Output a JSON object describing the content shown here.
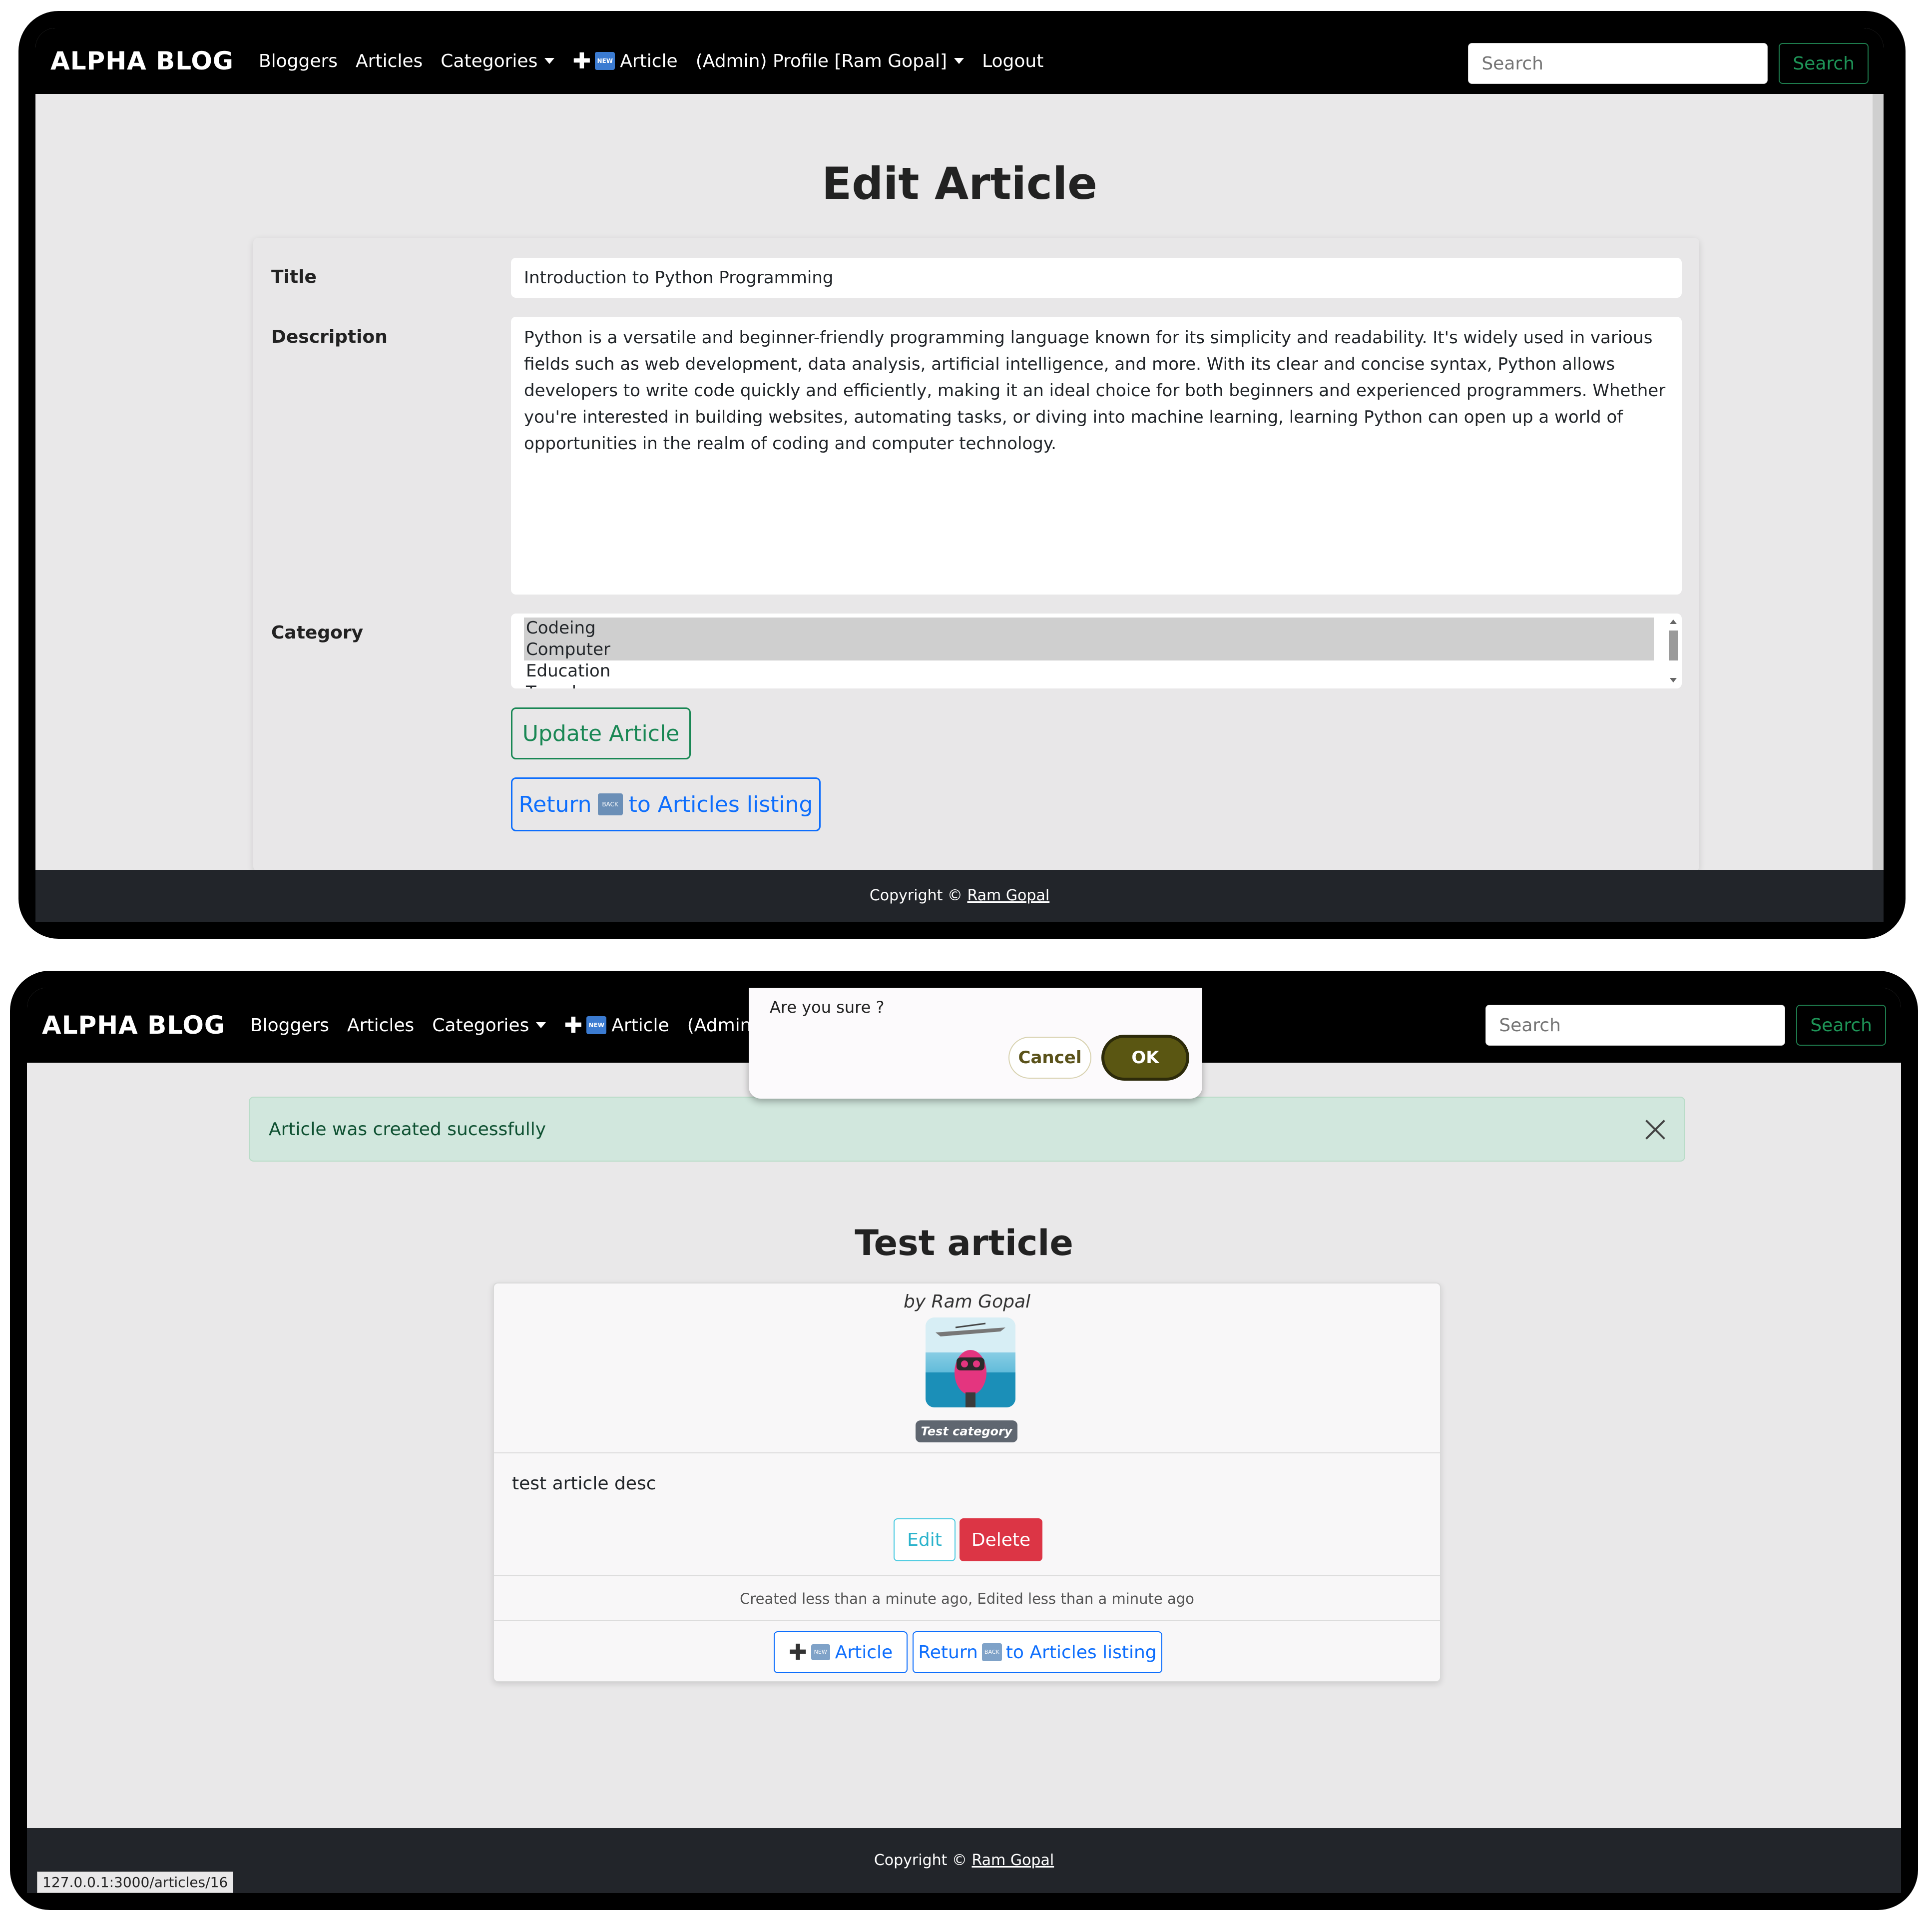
{
  "navbar": {
    "brand": "ALPHA BLOG",
    "items": {
      "bloggers": "Bloggers",
      "articles": "Articles",
      "categories": "Categories",
      "new_article": "Article",
      "profile": "(Admin) Profile [Ram Gopal]",
      "profile_truncated": "(Admin) P",
      "logout": "Logout"
    },
    "search_placeholder": "Search",
    "search_button": "Search"
  },
  "edit_page": {
    "heading": "Edit Article",
    "form": {
      "title_label": "Title",
      "title_value": "Introduction to Python Programming",
      "description_label": "Description",
      "description_value": "Python is a versatile and beginner-friendly programming language known for its simplicity and readability. It's widely used in various fields such as web development, data analysis, artificial intelligence, and more. With its clear and concise syntax, Python allows developers to write code quickly and efficiently, making it an ideal choice for both beginners and experienced programmers. Whether you're interested in building websites, automating tasks, or diving into machine learning, learning Python can open up a world of opportunities in the realm of coding and computer technology.",
      "category_label": "Category",
      "category_options": [
        "Codeing",
        "Computer",
        "Education",
        "Travel"
      ],
      "selected_categories": [
        "Codeing",
        "Computer"
      ],
      "update_button": "Update Article",
      "return_button_prefix": "Return",
      "return_button_suffix": "to Articles listing"
    },
    "footer": {
      "copyright": "Copyright ©",
      "author": "Ram Gopal"
    }
  },
  "show_page": {
    "confirm_dialog": {
      "message": "Are you sure ?",
      "cancel": "Cancel",
      "ok": "OK"
    },
    "alert": "Article was created sucessfully",
    "heading": "Test article",
    "card": {
      "byline": "by Ram Gopal",
      "category_badge": "Test category",
      "description": "test article desc",
      "edit_button": "Edit",
      "delete_button": "Delete",
      "meta": "Created less than a minute ago, Edited less than a minute ago",
      "new_article_button": "Article",
      "return_button_prefix": "Return",
      "return_button_suffix": "to Articles listing"
    },
    "footer": {
      "copyright": "Copyright ©",
      "author": "Ram Gopal"
    },
    "status_url": "127.0.0.1:3000/articles/16"
  },
  "colors": {
    "navbar_bg": "#000000",
    "page_bg": "#e9e8e9",
    "success": "#198754",
    "primary": "#0d6efd",
    "danger": "#dc3545",
    "info": "#2bb3cc",
    "dialog_ok": "#5a5612"
  },
  "icons": [
    "plus-icon",
    "new-icon",
    "back-icon",
    "close-icon",
    "chevron-down-icon",
    "avatar-robot"
  ]
}
